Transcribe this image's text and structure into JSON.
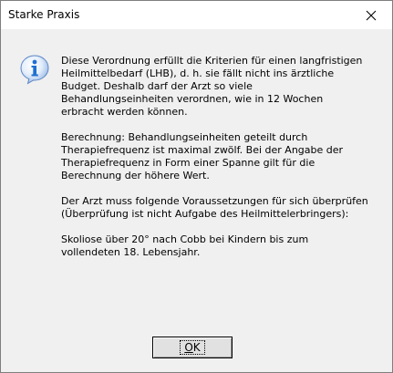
{
  "window": {
    "title": "Starke Praxis"
  },
  "message": {
    "icon": "information-icon",
    "paragraphs": [
      "Diese Verordnung erfüllt die Kriterien für einen langfristigen\nHeilmittelbedarf (LHB), d. h. sie fällt nicht ins ärztliche\nBudget. Deshalb darf der Arzt so viele\nBehandlungseinheiten verordnen, wie in 12 Wochen\nerbracht werden können.",
      "Berechnung: Behandlungseinheiten geteilt durch\nTherapiefrequenz ist maximal zwölf. Bei der Angabe der\nTherapiefrequenz in Form einer Spanne gilt für die\nBerechnung der höhere Wert.",
      "Der Arzt muss folgende Voraussetzungen für sich überprüfen\n(Überprüfung ist nicht Aufgabe des Heilmittelerbringers):",
      "Skoliose über 20° nach Cobb bei Kindern bis zum\nvollendeten 18. Lebensjahr."
    ]
  },
  "buttons": {
    "ok_accel": "O",
    "ok_rest": "K"
  },
  "colors": {
    "dialog_bg": "#f0f0f0",
    "icon_blue": "#1f6fd1"
  }
}
